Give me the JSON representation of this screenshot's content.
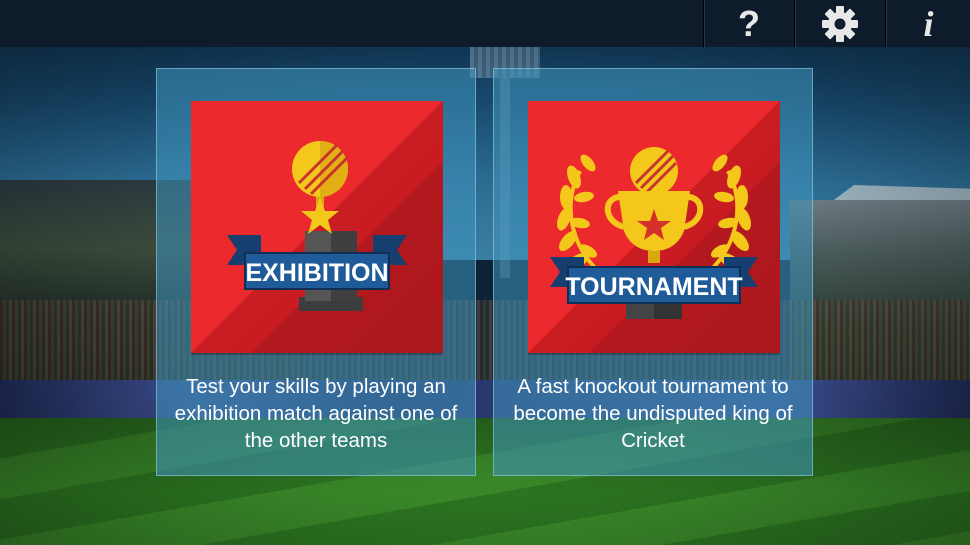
{
  "topbar": {
    "help_icon": "question-mark-icon",
    "settings_icon": "gear-icon",
    "info_icon": "info-icon",
    "help_glyph": "?",
    "info_glyph": "i"
  },
  "modes": [
    {
      "id": "exhibition",
      "title": "EXHIBITION",
      "description": "Test your skills by playing an exhibition match against one of the other teams",
      "icon": "trophy-icon"
    },
    {
      "id": "tournament",
      "title": "TOURNAMENT",
      "description": "A fast knockout tournament to become the undisputed king of Cricket",
      "icon": "cup-with-laurels-icon"
    }
  ],
  "colors": {
    "tile_red": "#ec2a2e",
    "banner_blue": "#1f5a99",
    "gold": "#f4c81a",
    "panel": "rgba(64,150,190,0.55)"
  }
}
